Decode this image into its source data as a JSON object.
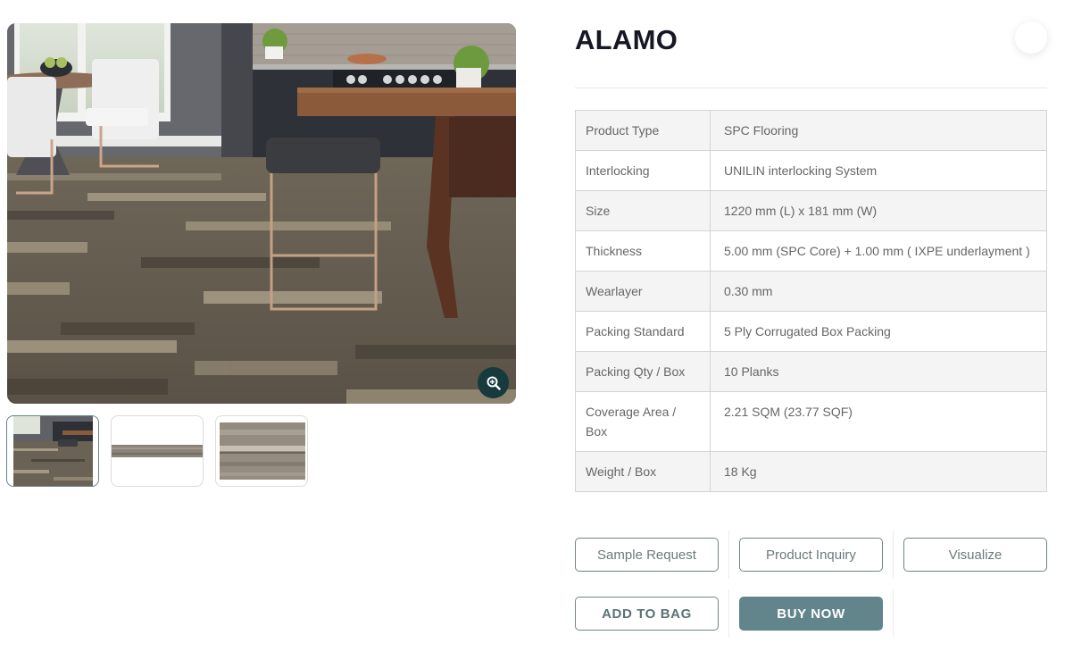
{
  "product": {
    "title": "ALAMO"
  },
  "gallery": {
    "main_image_alt": "Kitchen and dining room with grey-brown SPC wood plank flooring",
    "zoom_icon": "zoom-in-icon",
    "thumbnails": [
      {
        "alt": "Room scene",
        "active": true
      },
      {
        "alt": "Single plank",
        "active": false
      },
      {
        "alt": "Plank texture close-up",
        "active": false
      }
    ]
  },
  "specs": [
    {
      "label": "Product Type",
      "value": "SPC Flooring"
    },
    {
      "label": "Interlocking",
      "value": "UNILIN interlocking System"
    },
    {
      "label": "Size",
      "value": "1220 mm (L) x 181 mm (W)"
    },
    {
      "label": "Thickness",
      "value": "5.00 mm (SPC Core) + 1.00 mm ( IXPE underlayment )"
    },
    {
      "label": "Wearlayer",
      "value": "0.30 mm"
    },
    {
      "label": "Packing Standard",
      "value": "5 Ply Corrugated Box Packing"
    },
    {
      "label": "Packing Qty / Box",
      "value": "10 Planks"
    },
    {
      "label": "Coverage Area / Box",
      "value": "2.21 SQM (23.77 SQF)"
    },
    {
      "label": "Weight / Box",
      "value": "18 Kg"
    }
  ],
  "actions": {
    "sample_request": "Sample Request",
    "product_inquiry": "Product Inquiry",
    "visualize": "Visualize",
    "add_to_bag": "ADD TO BAG",
    "buy_now": "BUY NOW"
  },
  "colors": {
    "accent": "#61858a",
    "zoom_button": "#173a3d",
    "title": "#161625"
  }
}
